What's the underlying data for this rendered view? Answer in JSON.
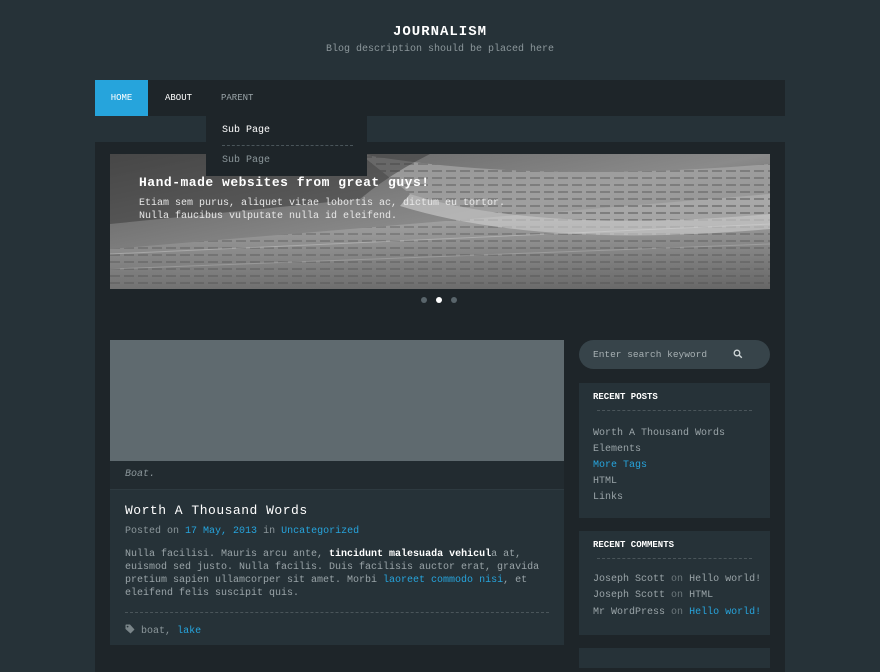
{
  "site": {
    "title": "JOURNALISM",
    "description": "Blog description should be placed here"
  },
  "nav": {
    "home": "HOME",
    "about": "ABOUT",
    "parent": "PARENT",
    "dropdown": [
      "Sub Page",
      "Sub Page"
    ]
  },
  "slider": {
    "title": "Hand-made websites from great guys!",
    "text": "Etiam sem purus, aliquet vitae lobortis ac, dictum eu tortor. Nulla faucibus vulputate nulla id eleifend.",
    "dots_count": 3,
    "active_dot": 1
  },
  "post": {
    "caption": "Boat.",
    "title": "Worth A Thousand Words",
    "meta_prefix": "Posted on",
    "date": "17 May, 2013",
    "meta_in": "in",
    "category": "Uncategorized",
    "body_1": "Nulla facilisi. Mauris arcu ante, ",
    "body_bold": "tincidunt malesuada vehicul",
    "body_2": "a at, euismod sed justo. Nulla facilis. Duis facilisis auctor erat, gravida pretium sapien ullamcorper sit amet. Morbi ",
    "body_link": "laoreet commodo nisi",
    "body_3": ", et eleifend felis suscipit quis.",
    "tag_1": "boat",
    "tag_sep": ",",
    "tag_2": "lake"
  },
  "search": {
    "placeholder": "Enter search keyword"
  },
  "recent_posts": {
    "title": "RECENT POSTS",
    "items": [
      "Worth A Thousand Words",
      "Elements",
      "More Tags",
      "HTML",
      "Links"
    ]
  },
  "recent_comments": {
    "title": "RECENT COMMENTS",
    "on": "on",
    "items": [
      {
        "author": "Joseph Scott",
        "post": "Hello world!"
      },
      {
        "author": "Joseph Scott",
        "post": "HTML"
      },
      {
        "author": "Mr WordPress",
        "post": "Hello world!"
      }
    ]
  },
  "colors": {
    "accent": "#26a4dc",
    "background": "#263238",
    "panel": "#1e2529",
    "text": "#9aa4a8"
  },
  "icons": [
    "search-icon",
    "tag-icon"
  ]
}
